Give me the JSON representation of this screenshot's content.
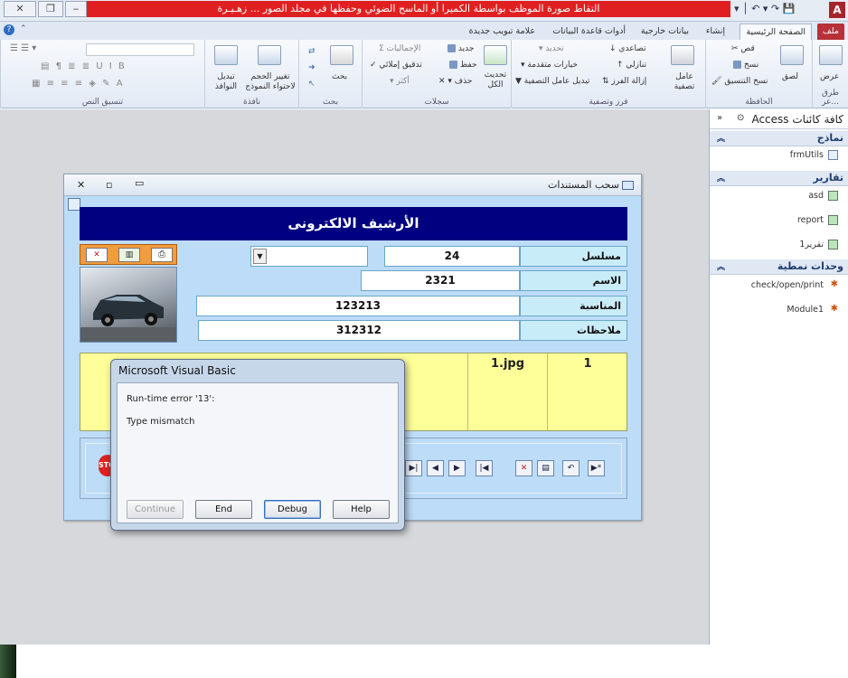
{
  "window": {
    "title": "التقاط صورة الموظف بواسطة الكميرا أو الماسح الضوئي وحفظها في مجلد الصور ... زهـيـرة",
    "app_icon": "A"
  },
  "tabs": [
    {
      "label": "ملف"
    },
    {
      "label": "الصفحة الرئيسية"
    },
    {
      "label": "إنشاء"
    },
    {
      "label": "بيانات خارجية"
    },
    {
      "label": "أدوات قاعدة البيانات"
    },
    {
      "label": "علامة تبويب جديدة"
    }
  ],
  "ribbon": {
    "views": {
      "label": "طرق عر...",
      "button": "عرض"
    },
    "clipboard": {
      "label": "الحافظة",
      "cut": "قص",
      "copy": "نسخ",
      "paste": "لصق",
      "format_painter": "نسخ التنسيق"
    },
    "sort_filter": {
      "label": "فرز وتصفية",
      "filter": "عامل تصفية",
      "asc": "تصاعدي",
      "desc": "تنازلي",
      "remove_sort": "إزالة الفرز",
      "selection": "تحديد",
      "advanced": "خيارات متقدمة",
      "toggle_filter": "تبديل عامل التصفية"
    },
    "records": {
      "label": "سجلات",
      "refresh": "تحديث الكل",
      "new": "جديد",
      "save": "حفظ",
      "delete": "حذف",
      "totals": "الإجماليات",
      "spelling": "تدقيق إملائي",
      "more": "أكثر"
    },
    "find": {
      "label": "بحث",
      "find": "بحث"
    },
    "window": {
      "label": "نافذة",
      "resize": "تغيير الحجم لاحتواء النموذج",
      "switch": "تبديل النوافذ"
    },
    "text_format": {
      "label": "تنسيق النص"
    }
  },
  "nav_pane": {
    "title": "كافة كائنات Access",
    "sections": [
      {
        "title": "نماذج",
        "items": [
          "frmUtils"
        ]
      },
      {
        "title": "تقارير",
        "items": [
          "asd",
          "report",
          "تقرير1"
        ]
      },
      {
        "title": "وحدات نمطية",
        "items": [
          "check/open/print",
          "Module1"
        ]
      }
    ]
  },
  "form": {
    "title": "سحب المستندات",
    "header": "الأرشيف الالكترونى",
    "fields": [
      {
        "label": "مسلسل",
        "value": "24"
      },
      {
        "label": "الاسم",
        "value": "2321"
      },
      {
        "label": "المناسبة",
        "value": "123213"
      },
      {
        "label": "ملاحظات",
        "value": "312312"
      }
    ],
    "subform": {
      "num": "1",
      "file": "1.jpg"
    },
    "combo_value": ""
  },
  "dialog": {
    "title": "Microsoft Visual Basic",
    "error": "Run-time error '13':",
    "message": "Type mismatch",
    "buttons": {
      "continue": "Continue",
      "end": "End",
      "debug": "Debug",
      "help": "Help"
    }
  }
}
